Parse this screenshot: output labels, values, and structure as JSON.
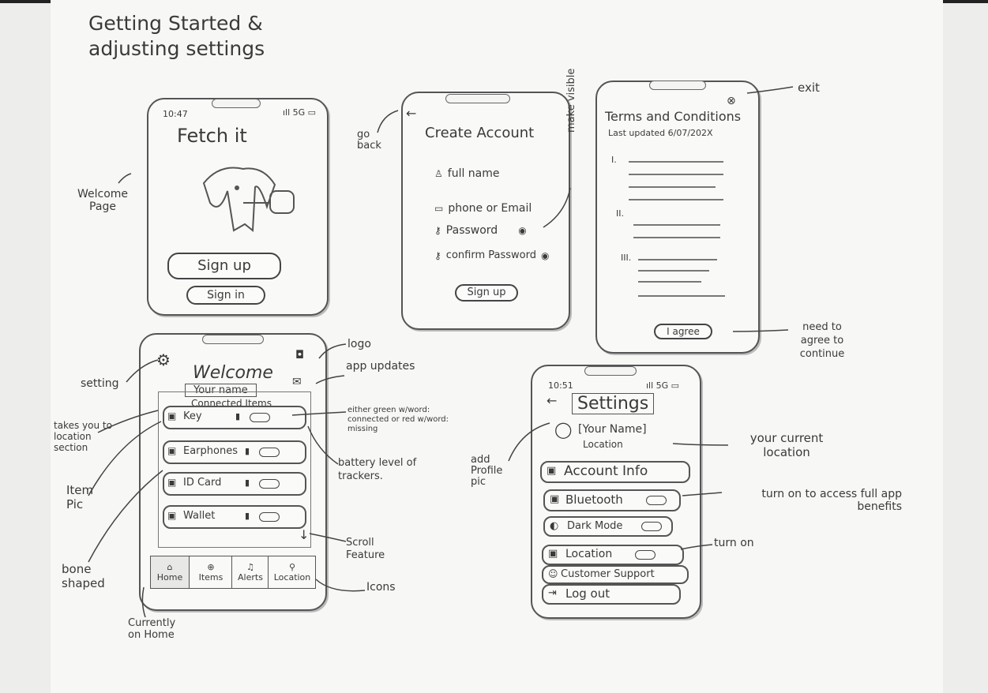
{
  "page_title": "Getting Started & adjusting settings",
  "welcome": {
    "time": "10:47",
    "signal": "ıll 5G ▭",
    "app_name": "Fetch it",
    "sign_up": "Sign up",
    "sign_in": "Sign in"
  },
  "create_account": {
    "title": "Create Account",
    "fields": [
      "full name",
      "phone or Email",
      "Password",
      "confirm Password"
    ],
    "sign_up": "Sign up"
  },
  "terms": {
    "title": "Terms and Conditions",
    "updated": "Last updated 6/07/202X",
    "sections": [
      "I.",
      "II.",
      "III."
    ],
    "agree": "I agree"
  },
  "home": {
    "welcome": "Welcome",
    "name": "Your name",
    "connected": "Connected Items",
    "items": [
      "Key",
      "Earphones",
      "ID Card",
      "Wallet"
    ],
    "tabs": [
      "Home",
      "Items",
      "Alerts",
      "Location"
    ]
  },
  "settings": {
    "time": "10:51",
    "signal": "ıll 5G ▭",
    "title": "Settings",
    "name": "[Your Name]",
    "location": "Location",
    "options": [
      "Account Info",
      "Bluetooth",
      "Dark Mode",
      "Location",
      "Customer Support",
      "Log out"
    ]
  },
  "annotations": {
    "welcome_page": "Welcome Page",
    "go_back": "go back",
    "make_visible": "make visible",
    "exit": "exit",
    "need_to_agree": "need to agree to continue",
    "logo": "logo",
    "setting": "setting",
    "app_updates": "app updates",
    "location_section": "takes you to location section",
    "either": "either green w/word: connected or red w/word: missing",
    "battery": "battery level of trackers.",
    "item_pic": "Item Pic",
    "bone_shaped": "bone shaped",
    "scroll_feature": "Scroll Feature",
    "icons": "Icons",
    "currently_home": "Currently on Home",
    "add_profile_pic": "add Profile pic",
    "current_location": "your current location",
    "turn_on_access": "turn on to access full app benefits",
    "turn_on": "turn on"
  }
}
